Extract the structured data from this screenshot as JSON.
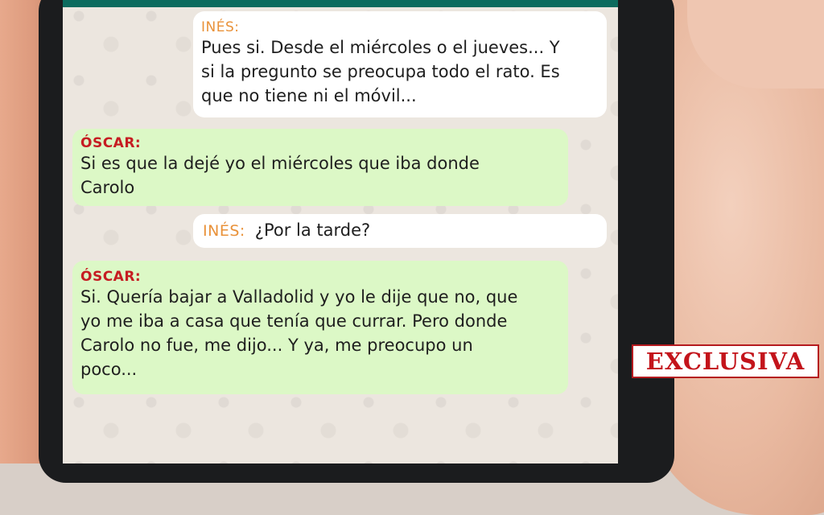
{
  "chat": {
    "messages": [
      {
        "sender": "INÉS:",
        "text": "Pues si. Desde el miércoles o el jueves... Y\nsi la pregunto se preocupa todo el rato. Es\nque no tiene ni el móvil..."
      },
      {
        "sender": "ÓSCAR:",
        "text": "Si es que la dejé yo el miércoles que iba donde\nCarolo"
      },
      {
        "sender": "INÉS:",
        "text": "¿Por la tarde?"
      },
      {
        "sender": "ÓSCAR:",
        "text": "Si. Quería bajar a Valladolid y yo le dije que no, que\nyo me iba a casa que tenía que currar. Pero donde\nCarolo no fue, me dijo... Y ya, me preocupo un\npoco..."
      }
    ]
  },
  "overlay": {
    "badge": "EXCLUSIVA"
  },
  "colors": {
    "incoming_bubble": "#ffffff",
    "outgoing_bubble": "#dcf8c6",
    "ines_name": "#e9923a",
    "oscar_name": "#c61c22",
    "header_bar": "#0c6b5e",
    "badge_text": "#c3141b"
  }
}
